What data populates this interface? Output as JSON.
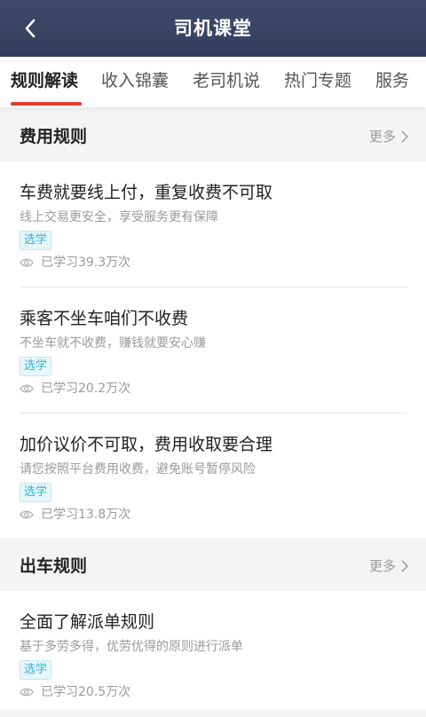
{
  "header": {
    "title": "司机课堂"
  },
  "tabs": [
    {
      "label": "规则解读"
    },
    {
      "label": "收入锦囊"
    },
    {
      "label": "老司机说"
    },
    {
      "label": "热门专题"
    },
    {
      "label": "服务"
    }
  ],
  "sections": [
    {
      "title": "费用规则",
      "more": "更多",
      "items": [
        {
          "title": "车费就要线上付，重复收费不可取",
          "desc": "线上交易更安全，享受服务更有保障",
          "tag": "选学",
          "stats": "已学习39.3万次"
        },
        {
          "title": "乘客不坐车咱们不收费",
          "desc": "不坐车就不收费，赚钱就要安心赚",
          "tag": "选学",
          "stats": "已学习20.2万次"
        },
        {
          "title": "加价议价不可取，费用收取要合理",
          "desc": "请您按照平台费用收费，避免账号暂停风险",
          "tag": "选学",
          "stats": "已学习13.8万次"
        }
      ]
    },
    {
      "title": "出车规则",
      "more": "更多",
      "items": [
        {
          "title": "全面了解派单规则",
          "desc": "基于多劳多得，优劳优得的原则进行派单",
          "tag": "选学",
          "stats": "已学习20.5万次"
        }
      ]
    }
  ],
  "colors": {
    "header_bg": "#3a4464",
    "accent": "#e8382f",
    "tag": "#2eb5d6"
  }
}
